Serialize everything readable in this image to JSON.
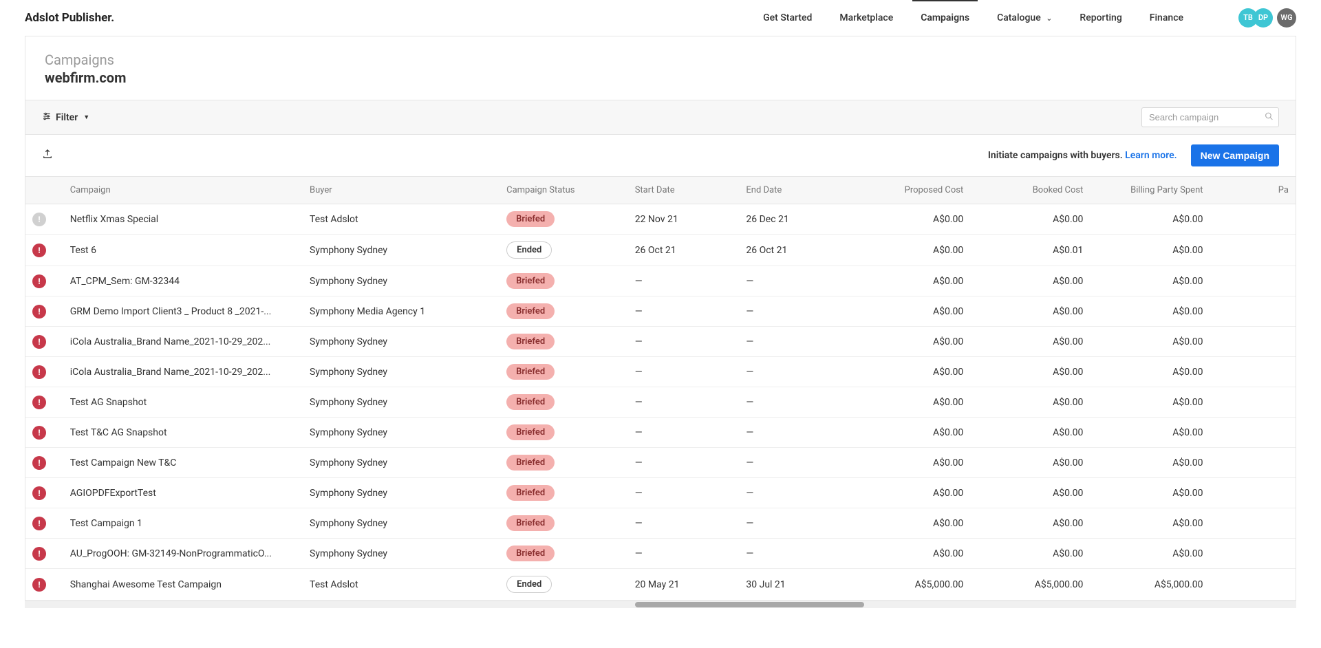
{
  "brand": "Adslot Publisher.",
  "nav": {
    "get_started": "Get Started",
    "marketplace": "Marketplace",
    "campaigns": "Campaigns",
    "catalogue": "Catalogue",
    "reporting": "Reporting",
    "finance": "Finance"
  },
  "avatars": {
    "a": "TB",
    "b": "DP",
    "c": "WG"
  },
  "page": {
    "label": "Campaigns",
    "value": "webfirm.com"
  },
  "toolbar": {
    "filter": "Filter",
    "search_placeholder": "Search campaign"
  },
  "actionbar": {
    "initiate": "Initiate campaigns with buyers. ",
    "learn_more": "Learn more.",
    "new_campaign": "New Campaign"
  },
  "cols": {
    "campaign": "Campaign",
    "buyer": "Buyer",
    "status": "Campaign Status",
    "start": "Start Date",
    "end": "End Date",
    "proposed": "Proposed Cost",
    "booked": "Booked Cost",
    "billing": "Billing Party Spent",
    "paid": "Pa"
  },
  "rows": [
    {
      "alert": "gray",
      "campaign": "Netflix Xmas Special",
      "buyer": "Test Adslot",
      "status": "Briefed",
      "status_kind": "briefed",
      "start": "22 Nov 21",
      "end": "26 Dec 21",
      "proposed": "A$0.00",
      "booked": "A$0.00",
      "billing": "A$0.00"
    },
    {
      "alert": "red",
      "campaign": "Test 6",
      "buyer": "Symphony Sydney",
      "status": "Ended",
      "status_kind": "ended",
      "start": "26 Oct 21",
      "end": "26 Oct 21",
      "proposed": "A$0.00",
      "booked": "A$0.01",
      "billing": "A$0.00"
    },
    {
      "alert": "red",
      "campaign": "AT_CPM_Sem: GM-32344",
      "buyer": "Symphony Sydney",
      "status": "Briefed",
      "status_kind": "briefed",
      "start": "—",
      "end": "—",
      "proposed": "A$0.00",
      "booked": "A$0.00",
      "billing": "A$0.00"
    },
    {
      "alert": "red",
      "campaign": "GRM Demo Import Client3 _ Product 8 _2021-...",
      "buyer": "Symphony Media Agency 1",
      "status": "Briefed",
      "status_kind": "briefed",
      "start": "—",
      "end": "—",
      "proposed": "A$0.00",
      "booked": "A$0.00",
      "billing": "A$0.00"
    },
    {
      "alert": "red",
      "campaign": "iCola Australia_Brand Name_2021-10-29_202...",
      "buyer": "Symphony Sydney",
      "status": "Briefed",
      "status_kind": "briefed",
      "start": "—",
      "end": "—",
      "proposed": "A$0.00",
      "booked": "A$0.00",
      "billing": "A$0.00"
    },
    {
      "alert": "red",
      "campaign": "iCola Australia_Brand Name_2021-10-29_202...",
      "buyer": "Symphony Sydney",
      "status": "Briefed",
      "status_kind": "briefed",
      "start": "—",
      "end": "—",
      "proposed": "A$0.00",
      "booked": "A$0.00",
      "billing": "A$0.00"
    },
    {
      "alert": "red",
      "campaign": "Test AG Snapshot",
      "buyer": "Symphony Sydney",
      "status": "Briefed",
      "status_kind": "briefed",
      "start": "—",
      "end": "—",
      "proposed": "A$0.00",
      "booked": "A$0.00",
      "billing": "A$0.00"
    },
    {
      "alert": "red",
      "campaign": "Test T&C AG Snapshot",
      "buyer": "Symphony Sydney",
      "status": "Briefed",
      "status_kind": "briefed",
      "start": "—",
      "end": "—",
      "proposed": "A$0.00",
      "booked": "A$0.00",
      "billing": "A$0.00"
    },
    {
      "alert": "red",
      "campaign": "Test Campaign New T&C",
      "buyer": "Symphony Sydney",
      "status": "Briefed",
      "status_kind": "briefed",
      "start": "—",
      "end": "—",
      "proposed": "A$0.00",
      "booked": "A$0.00",
      "billing": "A$0.00"
    },
    {
      "alert": "red",
      "campaign": "AGIOPDFExportTest",
      "buyer": "Symphony Sydney",
      "status": "Briefed",
      "status_kind": "briefed",
      "start": "—",
      "end": "—",
      "proposed": "A$0.00",
      "booked": "A$0.00",
      "billing": "A$0.00"
    },
    {
      "alert": "red",
      "campaign": "Test Campaign 1",
      "buyer": "Symphony Sydney",
      "status": "Briefed",
      "status_kind": "briefed",
      "start": "—",
      "end": "—",
      "proposed": "A$0.00",
      "booked": "A$0.00",
      "billing": "A$0.00"
    },
    {
      "alert": "red",
      "campaign": "AU_ProgOOH: GM-32149-NonProgrammaticO...",
      "buyer": "Symphony Sydney",
      "status": "Briefed",
      "status_kind": "briefed",
      "start": "—",
      "end": "—",
      "proposed": "A$0.00",
      "booked": "A$0.00",
      "billing": "A$0.00"
    },
    {
      "alert": "red",
      "campaign": "Shanghai Awesome Test Campaign",
      "buyer": "Test Adslot",
      "status": "Ended",
      "status_kind": "ended",
      "start": "20 May 21",
      "end": "30 Jul 21",
      "proposed": "A$5,000.00",
      "booked": "A$5,000.00",
      "billing": "A$5,000.00"
    }
  ]
}
